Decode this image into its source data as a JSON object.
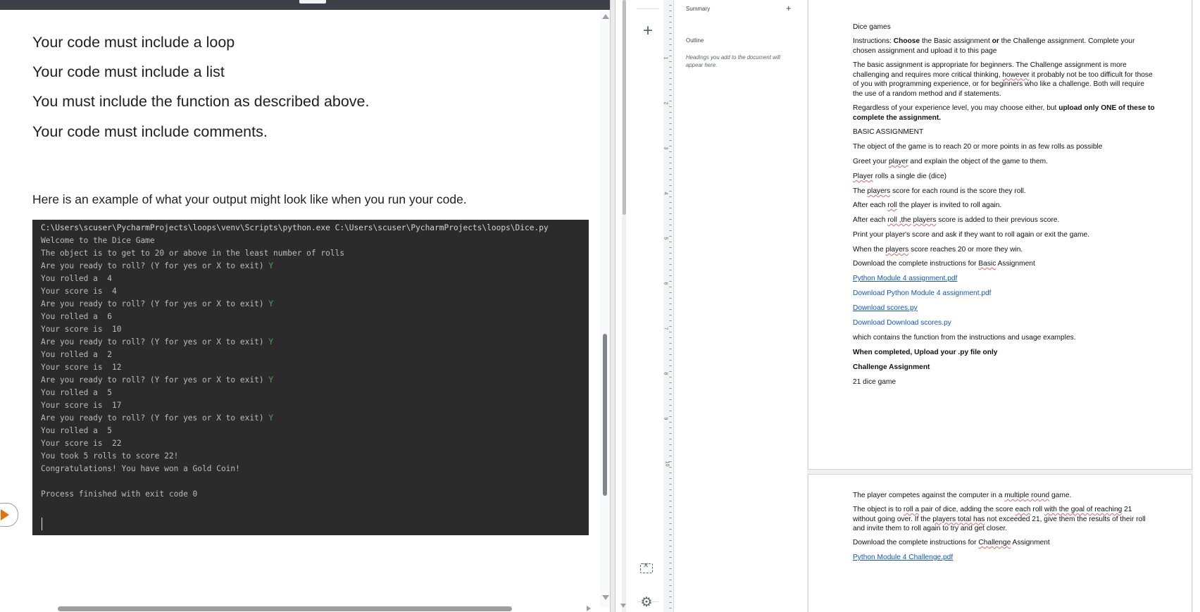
{
  "left": {
    "requirements": [
      "Your code must include a loop",
      "Your code must include a list",
      "You must include the function as described above.",
      "Your code must include comments."
    ],
    "example_intro": "Here is an example of what your output might look like when you run your code.",
    "terminal": {
      "path_line": "C:\\Users\\scuser\\PycharmProjects\\loops\\venv\\Scripts\\python.exe C:\\Users\\scuser\\PycharmProjects\\loops\\Dice.py",
      "lines": [
        {
          "text": "Welcome to the Dice Game",
          "input": ""
        },
        {
          "text": "The object is to get to 20 or above in the least number of rolls",
          "input": ""
        },
        {
          "text": "Are you ready to roll? (Y for yes or X to exit) ",
          "input": "Y"
        },
        {
          "text": "You rolled a  4",
          "input": ""
        },
        {
          "text": "Your score is  4",
          "input": ""
        },
        {
          "text": "Are you ready to roll? (Y for yes or X to exit) ",
          "input": "Y"
        },
        {
          "text": "You rolled a  6",
          "input": ""
        },
        {
          "text": "Your score is  10",
          "input": ""
        },
        {
          "text": "Are you ready to roll? (Y for yes or X to exit) ",
          "input": "Y"
        },
        {
          "text": "You rolled a  2",
          "input": ""
        },
        {
          "text": "Your score is  12",
          "input": ""
        },
        {
          "text": "Are you ready to roll? (Y for yes or X to exit) ",
          "input": "Y"
        },
        {
          "text": "You rolled a  5",
          "input": ""
        },
        {
          "text": "Your score is  17",
          "input": ""
        },
        {
          "text": "Are you ready to roll? (Y for yes or X to exit) ",
          "input": "Y"
        },
        {
          "text": "You rolled a  5",
          "input": ""
        },
        {
          "text": "Your score is  22",
          "input": ""
        },
        {
          "text": "You took 5 rolls to score 22!",
          "input": ""
        },
        {
          "text": "Congratulations! You have won a Gold Coin!",
          "input": ""
        },
        {
          "text": "",
          "input": ""
        },
        {
          "text": "Process finished with exit code 0",
          "input": ""
        }
      ],
      "input_color": "#4ea24e",
      "background": "#2b2b2b"
    },
    "play_icon_color": "#e8710a"
  },
  "rail": {
    "add_symbol": "+",
    "gear_symbol": "⚙"
  },
  "ruler_numbers": [
    "1",
    "2",
    "3",
    "4",
    "5",
    "6",
    "7",
    "8",
    "9",
    "10"
  ],
  "outline": {
    "summary_label": "Summary",
    "summary_add": "+",
    "outline_label": "Outline",
    "hint": "Headings you add to the document will appear here."
  },
  "doc": {
    "title": "Dice games",
    "instructions_prefix": "Instructions: ",
    "instructions_choose": "Choose",
    "instructions_mid": " the Basic assignment ",
    "instructions_or": "or",
    "instructions_rest": " the Challenge assignment. Complete your chosen assignment and upload it to this page",
    "basic_para_1": "The basic assignment is appropriate for beginners.  The Challenge assignment is more challenging and requires more critical thinking, ",
    "basic_para_however": "however",
    "basic_para_2": " it probably not be too difficult for those of you with programming experience, or for beginners who like a challenge. Both will require the use of a random method and if statements.",
    "regardless_1": "Regardless of your experience level, you may choose either, but ",
    "regardless_bold": "upload only ONE of these to complete the assignment.",
    "basic_heading": "BASIC ASSIGNMENT",
    "object": "The object of the game is to reach 20 or more points in as few rolls as possible",
    "greet_1": "Greet your ",
    "greet_player": "player",
    "greet_2": " and explain the object of the game to them.",
    "rolls_player": "Player",
    "rolls_rest": " rolls a single die (dice)",
    "score_1": "The ",
    "score_players": "players",
    "score_2": " score for each round is the score they roll.",
    "after1_1": "After each ",
    "after1_roll": "roll",
    "after1_2": " the player is invited to roll again.",
    "after2_1": "After each ",
    "after2_roll": "roll ,the",
    "after2_mid": " ",
    "after2_players": "players",
    "after2_2": " score is added to their previous score.",
    "print_line": "Print your player's score and ask if they want to roll again or exit the game.",
    "when_1": "When the ",
    "when_players": "players",
    "when_2": " score reaches 20 or more they win.",
    "download_basic_1": "Download the complete instructions for ",
    "download_basic_word": "Basic",
    "download_basic_2": " Assignment",
    "link1": "Python Module 4 assignment.pdf",
    "link2": "Download Python Module 4 assignment.pdf",
    "link3": "Download scores.py",
    "link4": "Download Download scores.py",
    "contains": "which contains the function from the instructions and usage examples.",
    "upload_line": "When completed, Upload your .py file only",
    "challenge_heading": "Challenge Assignment",
    "game21": "21 dice game",
    "p2_competes_1": "The player competes against the computer in a ",
    "p2_competes_sq": "multiple round",
    "p2_competes_2": " game.",
    "p2_object_1": "The object is to ",
    "p2_object_sq1": "roll  a",
    "p2_object_2": " pair of dice,  adding the score ",
    "p2_object_sq2": "each",
    "p2_object_3": " roll ",
    "p2_object_sq3": "with the goal of reaching",
    "p2_object_4": " 21 without going over.  If the ",
    "p2_object_sq4": "players total  has",
    "p2_object_5": " not exceeded 21, give them the results of their roll and invite them to roll again to try and get closer.",
    "download_ch_1": "Download the complete instructions for ",
    "download_ch_word": "Challenge",
    "download_ch_2": " Assignment",
    "link5": "Python Module 4 Challenge.pdf"
  }
}
